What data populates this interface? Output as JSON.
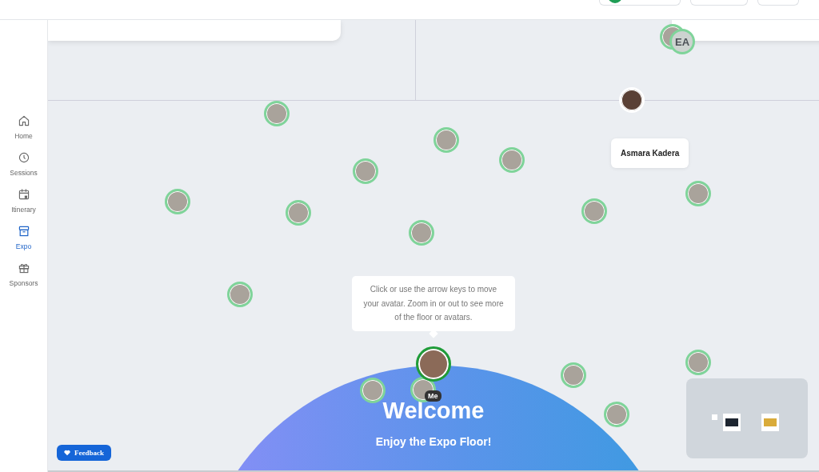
{
  "sidebar": {
    "items": [
      {
        "label": "Home",
        "selected": false
      },
      {
        "label": "Sessions",
        "selected": false
      },
      {
        "label": "Itinerary",
        "selected": false
      },
      {
        "label": "Expo",
        "selected": true
      },
      {
        "label": "Sponsors",
        "selected": false
      }
    ]
  },
  "floor": {
    "initials_avatar": "EA",
    "hover_name": "Asmara Kadera",
    "hint": "Click or use the arrow keys to move your avatar. Zoom in or out to see more of the floor or avatars.",
    "me_label": "Me",
    "welcome": {
      "title": "Welcome",
      "subtitle": "Enjoy the Expo Floor!"
    }
  },
  "feedback_button": {
    "label": "Feedback"
  }
}
